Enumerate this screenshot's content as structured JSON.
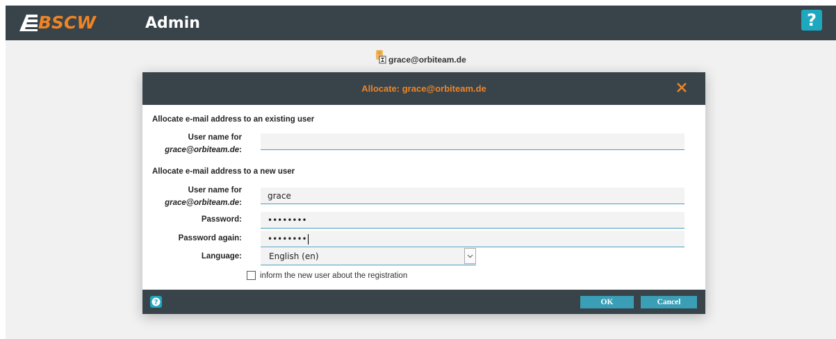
{
  "header": {
    "logo_text": "BSCW",
    "title": "Admin",
    "help_label": "?"
  },
  "breadcrumb": {
    "text": "grace@orbiteam.de"
  },
  "dialog": {
    "title": "Allocate: grace@orbiteam.de",
    "existing_section": {
      "title": "Allocate e-mail address to an existing user",
      "label_line1": "User name for",
      "label_line2_email": "grace@orbiteam.de",
      "label_colon": ":",
      "value": ""
    },
    "new_section": {
      "title": "Allocate e-mail address to a new user",
      "username_label_line1": "User name for",
      "username_label_email": "grace@orbiteam.de",
      "username_label_colon": ":",
      "username_value": "grace",
      "password_label": "Password:",
      "password_value": "••••••••",
      "password_again_label": "Password again:",
      "password_again_value": "••••••••",
      "language_label": "Language:",
      "language_value": "English (en)",
      "inform_label": "inform the new user about the registration",
      "inform_checked": false
    },
    "footer": {
      "ok_label": "OK",
      "cancel_label": "Cancel"
    }
  },
  "colors": {
    "topbar": "#38444a",
    "accent_orange": "#ee8424",
    "accent_teal": "#1ea8c0",
    "button": "#3a9fb6"
  }
}
